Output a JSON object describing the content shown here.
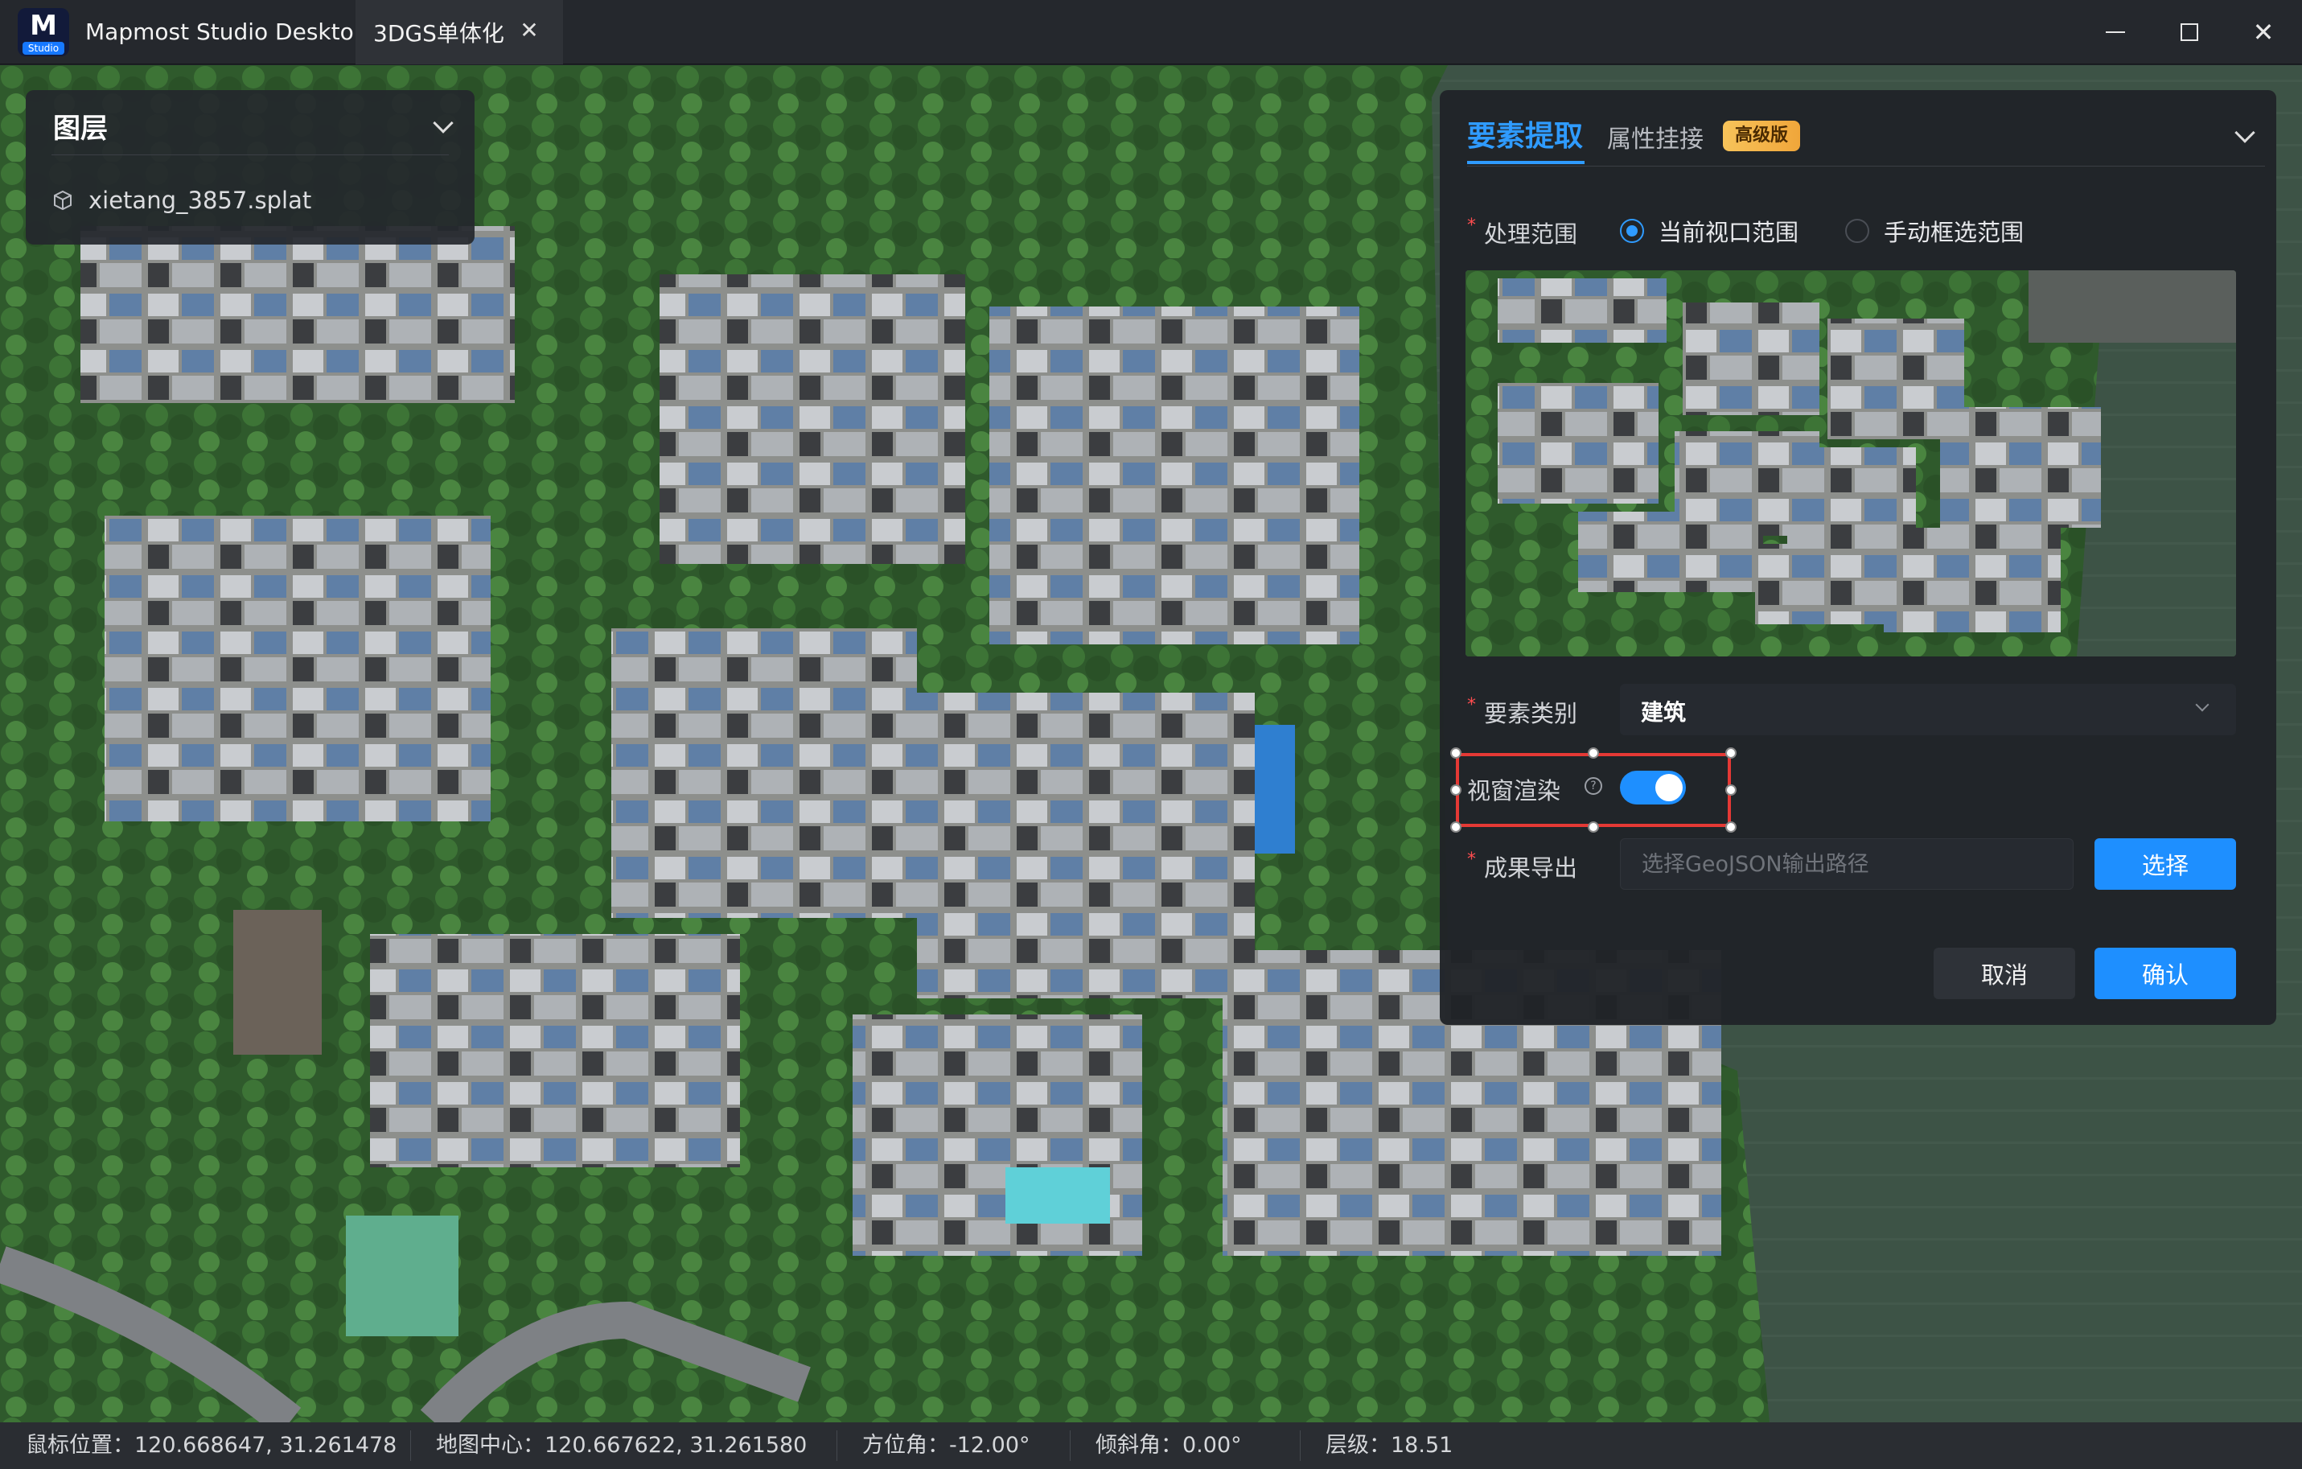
{
  "window": {
    "app_title": "Mapmost Studio Desktop",
    "logo_letter": "M",
    "logo_tag": "Studio",
    "tab_label": "3DGS单体化",
    "tab_close": "✕",
    "close_glyph": "✕"
  },
  "layers_panel": {
    "title": "图层",
    "items": [
      {
        "label": "xietang_3857.splat",
        "icon": "cube-icon"
      }
    ]
  },
  "extract_panel": {
    "tabs": [
      {
        "label": "要素提取",
        "active": true
      },
      {
        "label": "属性挂接",
        "active": false
      }
    ],
    "badge": "高级版",
    "range": {
      "label": "处理范围",
      "options": [
        {
          "label": "当前视口范围",
          "selected": true
        },
        {
          "label": "手动框选范围",
          "selected": false
        }
      ]
    },
    "category": {
      "label": "要素类别",
      "value": "建筑"
    },
    "viewport_render": {
      "label": "视窗渲染",
      "enabled": true
    },
    "export": {
      "label": "成果导出",
      "placeholder": "选择GeoJSON输出路径",
      "value": "",
      "button": "选择"
    },
    "cancel": "取消",
    "confirm": "确认",
    "required_mark": "*"
  },
  "status_bar": {
    "mouse": "鼠标位置：120.668647, 31.261478",
    "center": "地图中心：120.667622, 31.261580",
    "azimuth": "方位角：-12.00°",
    "tilt": "倾斜角：0.00°",
    "zoom": "层级：18.51"
  },
  "colors": {
    "accent": "#1e8fff",
    "highlight_border": "#e53935",
    "badge": "#f7c35a",
    "required": "#ff4d4f"
  }
}
